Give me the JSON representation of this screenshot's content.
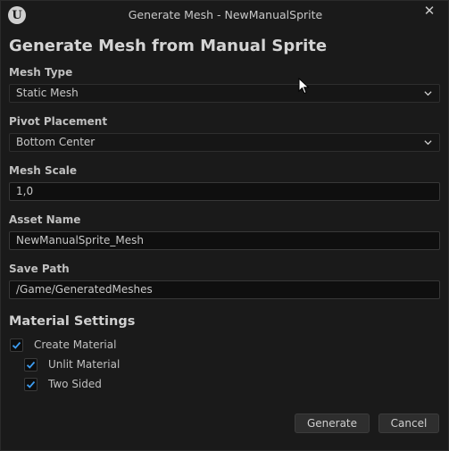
{
  "window": {
    "title": "Generate Mesh - NewManualSprite",
    "close_glyph": "✕",
    "logo_glyph": "U"
  },
  "heading": "Generate Mesh from Manual Sprite",
  "fields": {
    "mesh_type": {
      "label": "Mesh Type",
      "value": "Static Mesh"
    },
    "pivot_placement": {
      "label": "Pivot Placement",
      "value": "Bottom Center"
    },
    "mesh_scale": {
      "label": "Mesh Scale",
      "value": "1,0"
    },
    "asset_name": {
      "label": "Asset Name",
      "value": "NewManualSprite_Mesh"
    },
    "save_path": {
      "label": "Save Path",
      "value": "/Game/GeneratedMeshes"
    }
  },
  "material_settings": {
    "heading": "Material Settings",
    "create_material": {
      "label": "Create Material",
      "checked": true
    },
    "unlit_material": {
      "label": "Unlit Material",
      "checked": true
    },
    "two_sided": {
      "label": "Two Sided",
      "checked": true
    }
  },
  "buttons": {
    "generate": "Generate",
    "cancel": "Cancel"
  },
  "colors": {
    "background": "#1a1a1a",
    "field_bg": "#0f0f0f",
    "check_accent": "#3d9cf0",
    "button_bg": "#2e2e2e"
  },
  "icons": [
    "unreal-logo-icon",
    "close-icon",
    "chevron-down-icon",
    "checkmark-icon",
    "mouse-cursor-icon"
  ]
}
